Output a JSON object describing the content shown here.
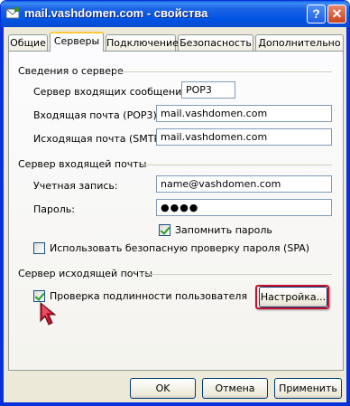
{
  "window": {
    "title": "mail.vashdomen.com - свойства",
    "help_label": "?",
    "close_label": "✕"
  },
  "tabs": [
    {
      "label": "Общие",
      "active": false
    },
    {
      "label": "Серверы",
      "active": true
    },
    {
      "label": "Подключение",
      "active": false
    },
    {
      "label": "Безопасность",
      "active": false
    },
    {
      "label": "Дополнительно",
      "active": false
    }
  ],
  "server_info": {
    "group_label": "Сведения о сервере",
    "incoming_type_label": "Сервер входящих сообщений:",
    "incoming_type_value": "POP3",
    "incoming_label": "Входящая почта (POP3):",
    "incoming_value": "mail.vashdomen.com",
    "outgoing_label": "Исходящая почта (SMTP):",
    "outgoing_value": "mail.vashdomen.com"
  },
  "incoming_server": {
    "group_label": "Сервер входящей почты",
    "account_label": "Учетная запись:",
    "account_value": "name@vashdomen.com",
    "password_label": "Пароль:",
    "password_value": "●●●●",
    "remember_label": "Запомнить пароль",
    "remember_checked": true,
    "spa_label": "Использовать безопасную проверку пароля (SPA)",
    "spa_checked": false
  },
  "outgoing_server": {
    "group_label": "Сервер исходящей почты",
    "auth_label": "Проверка подлинности пользователя",
    "auth_checked": true,
    "settings_button": "Настройка..."
  },
  "footer": {
    "ok": "OK",
    "cancel": "Отмена",
    "apply": "Применить"
  },
  "colors": {
    "titlebar": "#0054e3",
    "dialog_bg": "#ece9d8",
    "highlight": "#c8102e",
    "check": "#21a121"
  },
  "icons": {
    "title": "mail-envelope-icon",
    "cursor": "mouse-pointer-icon"
  }
}
